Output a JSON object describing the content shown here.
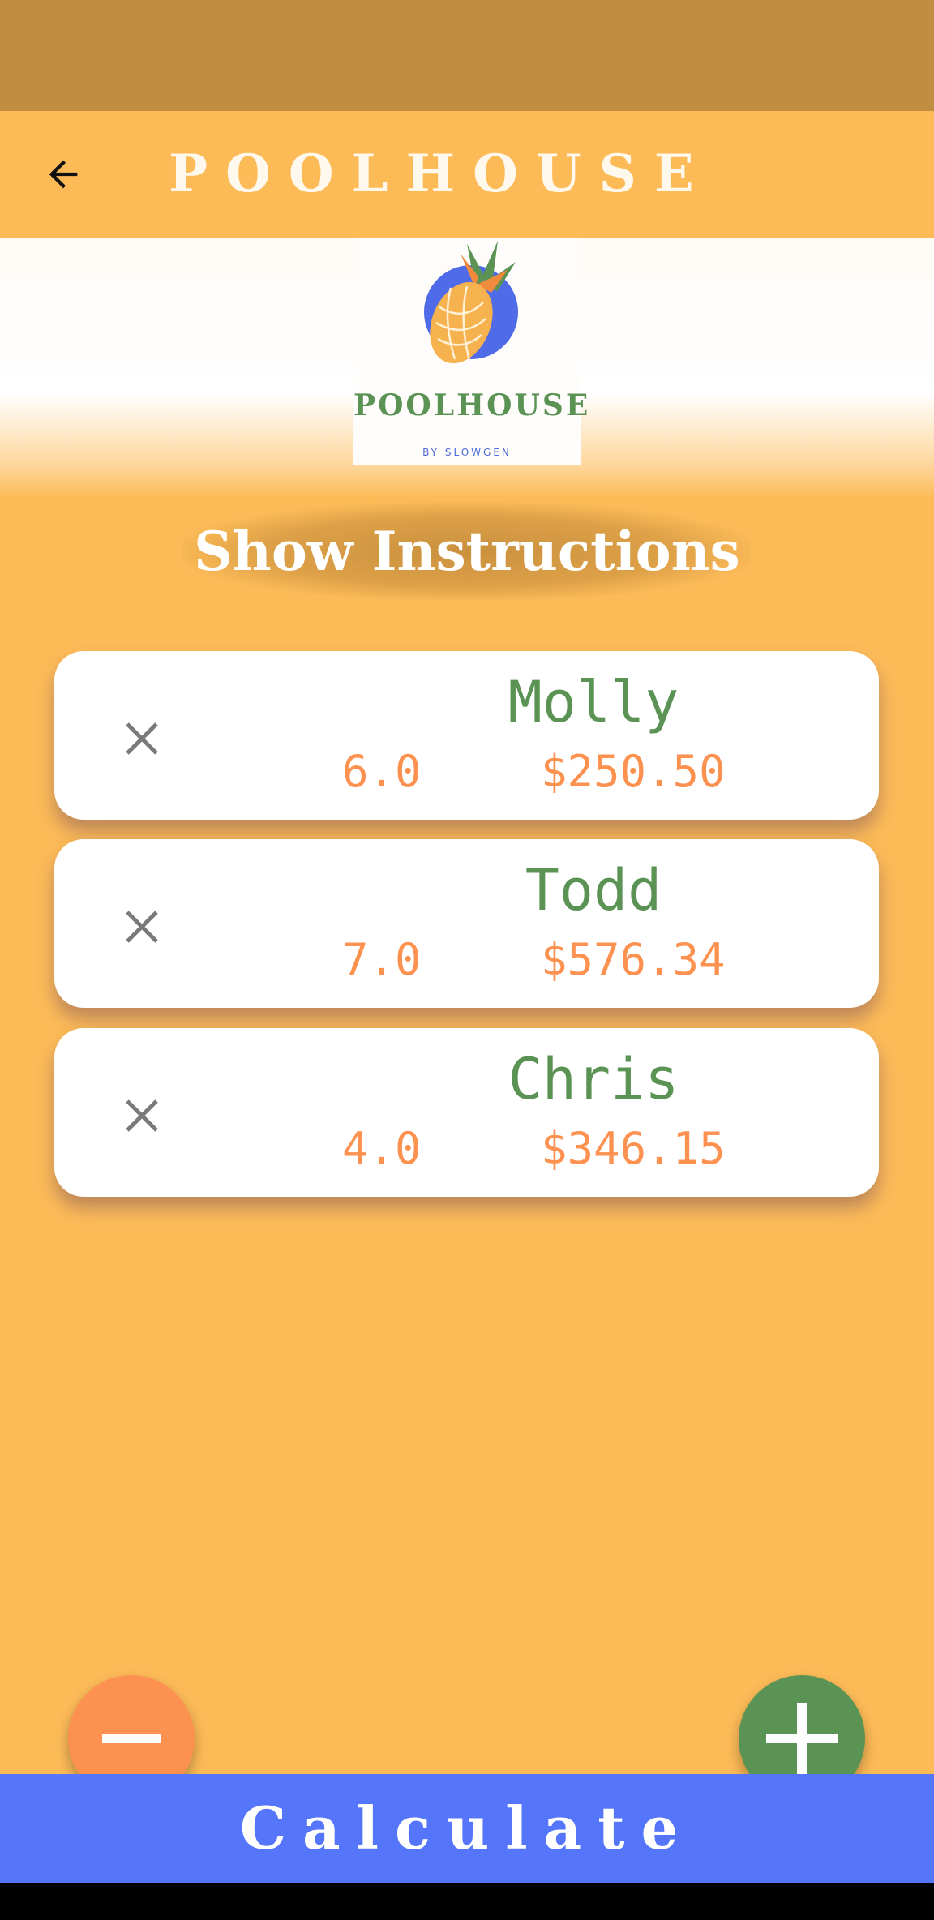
{
  "app_bar": {
    "title": "POOLHOUSE"
  },
  "logo": {
    "wordmark": "POOLHOUSE",
    "subtitle": "BY SLOWGEN"
  },
  "instructions": {
    "label": "Show Instructions"
  },
  "people": [
    {
      "name": "Molly",
      "hours": "6.0",
      "amount": "$250.50"
    },
    {
      "name": "Todd",
      "hours": "7.0",
      "amount": "$576.34"
    },
    {
      "name": "Chris",
      "hours": "4.0",
      "amount": "$346.15"
    }
  ],
  "actions": {
    "calculate_label": "Calculate"
  },
  "colors": {
    "background": "#FDBB58",
    "status_bar": "#C08D42",
    "accent_green": "#5B9355",
    "accent_orange": "#FD9150",
    "calculate_blue": "#5575FA"
  },
  "icons": {
    "back": "arrow-left-icon",
    "remove": "close-icon",
    "minus": "minus-icon",
    "plus": "plus-icon"
  }
}
